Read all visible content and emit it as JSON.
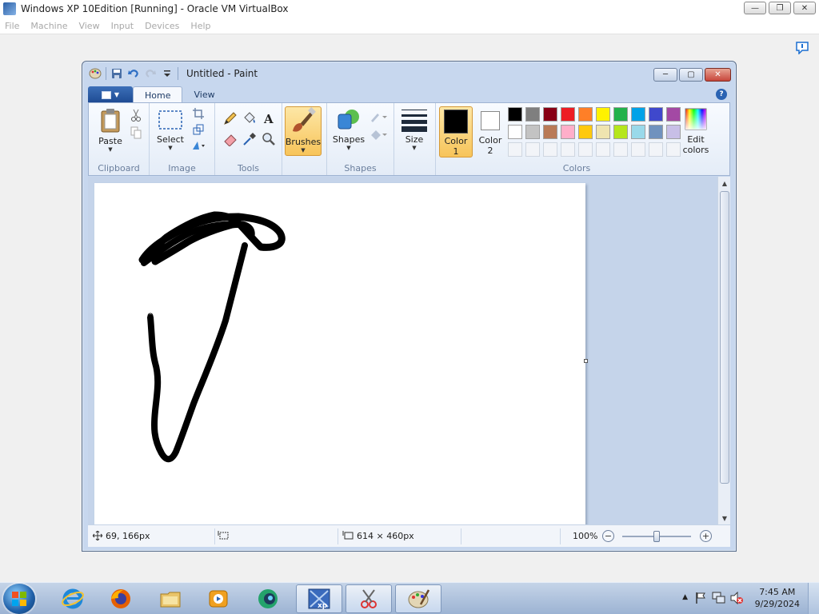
{
  "host": {
    "title": "Windows XP 10Edition [Running] - Oracle VM VirtualBox",
    "menu": [
      "File",
      "Machine",
      "View",
      "Input",
      "Devices",
      "Help"
    ]
  },
  "paint": {
    "title": "Untitled - Paint",
    "tabs": [
      "Home",
      "View"
    ],
    "clipboard": {
      "paste": "Paste",
      "group": "Clipboard"
    },
    "image": {
      "select": "Select",
      "group": "Image"
    },
    "tools": {
      "group": "Tools"
    },
    "brushes": {
      "label": "Brushes"
    },
    "shapes": {
      "label": "Shapes",
      "group": "Shapes"
    },
    "size": {
      "label": "Size"
    },
    "colors": {
      "color1_line1": "Color",
      "color1_line2": "1",
      "color2_line1": "Color",
      "color2_line2": "2",
      "edit_line1": "Edit",
      "edit_line2": "colors",
      "group": "Colors",
      "color1_value": "#000000",
      "color2_value": "#ffffff",
      "palette_row1": [
        "#000000",
        "#7f7f7f",
        "#880015",
        "#ed1c24",
        "#ff7f27",
        "#fff200",
        "#22b14c",
        "#00a2e8",
        "#3f48cc",
        "#a349a4"
      ],
      "palette_row2": [
        "#ffffff",
        "#c3c3c3",
        "#b97a57",
        "#ffaec9",
        "#ffc90e",
        "#efe4b0",
        "#b5e61d",
        "#99d9ea",
        "#7092be",
        "#c8bfe7"
      ]
    },
    "status": {
      "cursor_pos": "69, 166px",
      "canvas_size": "614 × 460px",
      "zoom": "100%"
    }
  },
  "taskbar": {
    "time": "7:45 AM",
    "date": "9/29/2024"
  }
}
